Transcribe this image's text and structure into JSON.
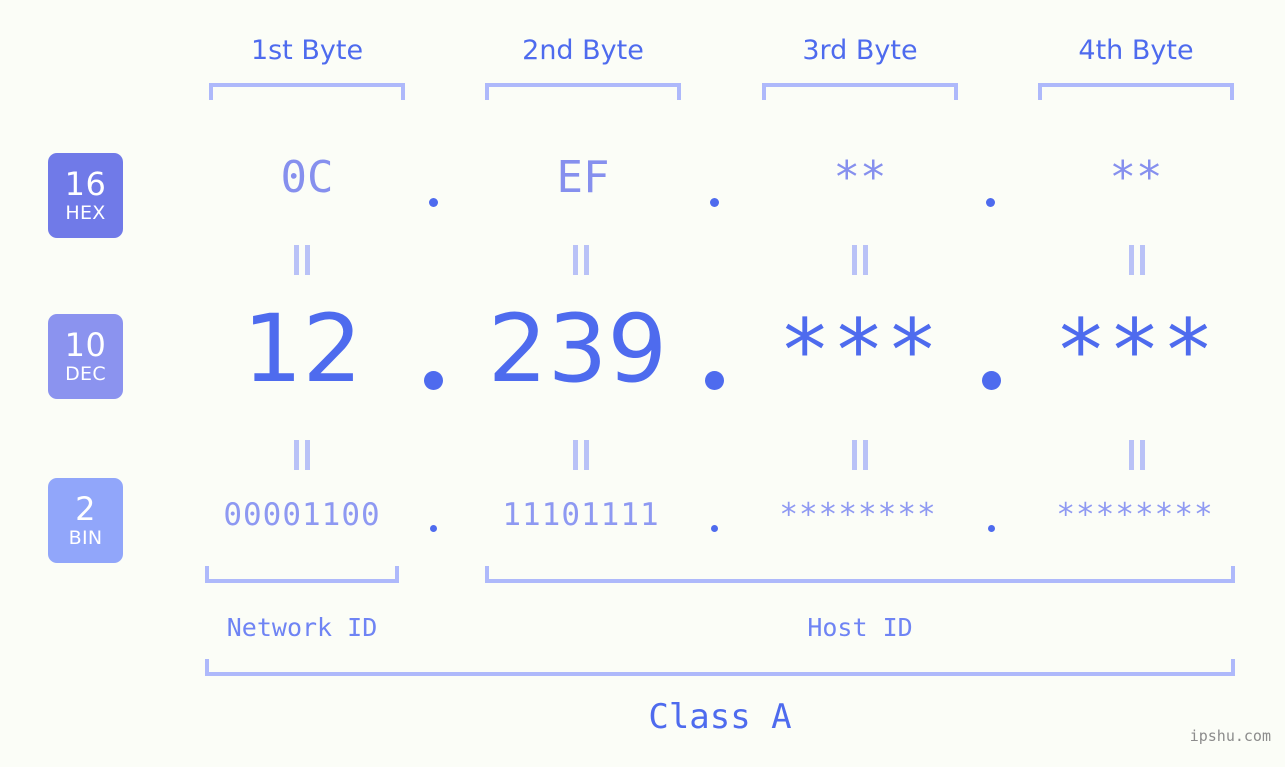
{
  "page": {
    "background_color": "#fbfdf7",
    "accent_color": "#4e6bee",
    "muted_accent_color": "#8690ee",
    "bracket_color": "#aeb9fb",
    "watermark": "ipshu.com"
  },
  "byte_headers": [
    {
      "label": "1st Byte"
    },
    {
      "label": "2nd Byte"
    },
    {
      "label": "3rd Byte"
    },
    {
      "label": "4th Byte"
    }
  ],
  "rows": [
    {
      "id": "hex",
      "badge_number": "16",
      "badge_name": "HEX",
      "badge_color": "#707ae8",
      "values": [
        "0C",
        "EF",
        "**",
        "**"
      ],
      "separator": "."
    },
    {
      "id": "dec",
      "badge_number": "10",
      "badge_name": "DEC",
      "badge_color": "#8b93ef",
      "values": [
        "12",
        "239",
        "***",
        "***"
      ],
      "separator": "."
    },
    {
      "id": "bin",
      "badge_number": "2",
      "badge_name": "BIN",
      "badge_color": "#91a6fa",
      "values": [
        "00001100",
        "11101111",
        "********",
        "********"
      ],
      "separator": "."
    }
  ],
  "equality_symbol": "=",
  "segments": [
    {
      "label": "Network ID"
    },
    {
      "label": "Host ID"
    }
  ],
  "ip_class": {
    "label": "Class A"
  }
}
